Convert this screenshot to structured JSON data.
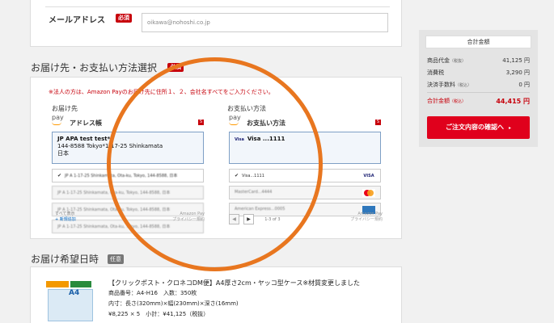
{
  "email": {
    "label": "メールアドレス",
    "required": "必須",
    "value": "oikawa@nohoshi.co.jp"
  },
  "shipping_section": {
    "title": "お届け先・お支払い方法選択",
    "required": "必須",
    "notice": "※法人の方は、Amazon Payのお届け先に住所１、２、会社名すべてをご入力ください。",
    "address": {
      "column_label": "お届け先",
      "pay_logo": "pay",
      "widget_title": "アドレス帳",
      "tag": "S",
      "selected_lines": [
        "JP APA test test*",
        "144-8588 Tokyo*1-17-25 Shinkamata",
        "日本"
      ],
      "rows": [
        "JP A 1-17-25 Shinkamata, Ota-ku, Tokyo, 144-8588, 日本",
        "JP A 1-17-25 Shinkamata, Ota-ku, Tokyo, 144-8588, 日本",
        "JP A 1-17-25 Shinkamata, Ota-ku, Tokyo, 144-8588, 日本",
        "JP A 1-17-25 Shinkamata, Ota-ku, Tokyo, 144-8588, 日本"
      ],
      "show_all": "すべて表示",
      "new_address": "+ 新規追加",
      "footer_brand": "Amazon Pay",
      "footer_privacy": "プライバシー規約"
    },
    "payment": {
      "column_label": "お支払い方法",
      "pay_logo": "pay",
      "widget_title": "お支払い方法",
      "tag": "S",
      "selected_brand": "Visa",
      "selected_number": "Visa ...1111",
      "rows": [
        {
          "text": "Visa...1111",
          "logo": "visa-logo"
        },
        {
          "text": "MasterCard...4444",
          "logo": "mastercard-logo"
        },
        {
          "text": "American Express...0005",
          "logo": "amex-logo"
        }
      ],
      "visa_text": "VISA",
      "pager_text": "1-3 of 3",
      "pager_prev": "◀",
      "pager_next": "▶",
      "footer_brand": "Amazon Pay",
      "footer_privacy": "プライバシー規約"
    }
  },
  "delivery": {
    "title": "お届け希望日時",
    "optional": "任意"
  },
  "product": {
    "name": "【クリックポスト・クロネコDM便】A4厚さ2cm・ヤッコ型ケース※材質変更しました",
    "code": "商品番号：A4-H16　入数：350枚",
    "size": "内寸：長さ(320mm)×幅(230mm)×深さ(16mm)",
    "price": "¥8,225 × 5　小計：¥41,125（税抜）",
    "image_label": "A4"
  },
  "summary": {
    "title": "合計金額",
    "rows": [
      {
        "label": "商品代金",
        "sub": "（税抜）",
        "value": "41,125 円"
      },
      {
        "label": "消費税",
        "sub": "",
        "value": "3,290 円"
      },
      {
        "label": "決済手数料",
        "sub": "（税込）",
        "value": "0 円"
      }
    ],
    "total_label": "合計金額",
    "total_sub": "（税込）",
    "total_value": "44,415 円",
    "confirm_button": "ご注文内容の確認へ",
    "confirm_arrow": "▸"
  },
  "annotation": {
    "color": "#e8761f"
  },
  "colors": {
    "accent": "#c7000b",
    "button": "#e0001c",
    "selected_border": "#7e9fc5"
  }
}
